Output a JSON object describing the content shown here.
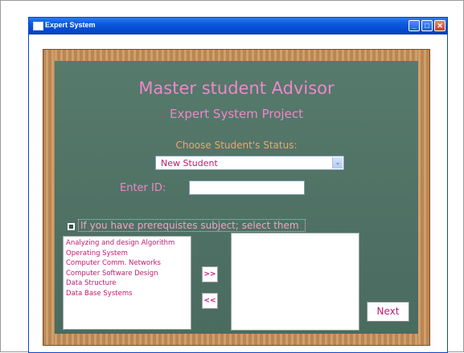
{
  "window": {
    "title": "Expert System"
  },
  "header": {
    "title": "Master student Advisor",
    "subtitle": "Expert System Project"
  },
  "status": {
    "label": "Choose Student's Status:",
    "selected": "New Student",
    "arrow": "⌄"
  },
  "id_field": {
    "label": "Enter ID:",
    "value": ""
  },
  "prerequisites": {
    "checkbox_label": "If you have prerequistes subject; select them",
    "available": [
      "Analyzing and design Algorithm",
      "Operating System",
      "Computer Comm. Networks",
      "Computer Software Design",
      "Data Structure",
      "Data Base Systems"
    ],
    "selected": [],
    "add_label": ">>",
    "remove_label": "<<"
  },
  "next_label": "Next",
  "colors": {
    "board": "#4d6f63",
    "frame": "#c4905b",
    "title_pink": "#ef87c9",
    "status_orange": "#f0a56e",
    "list_text": "#c2186f"
  }
}
